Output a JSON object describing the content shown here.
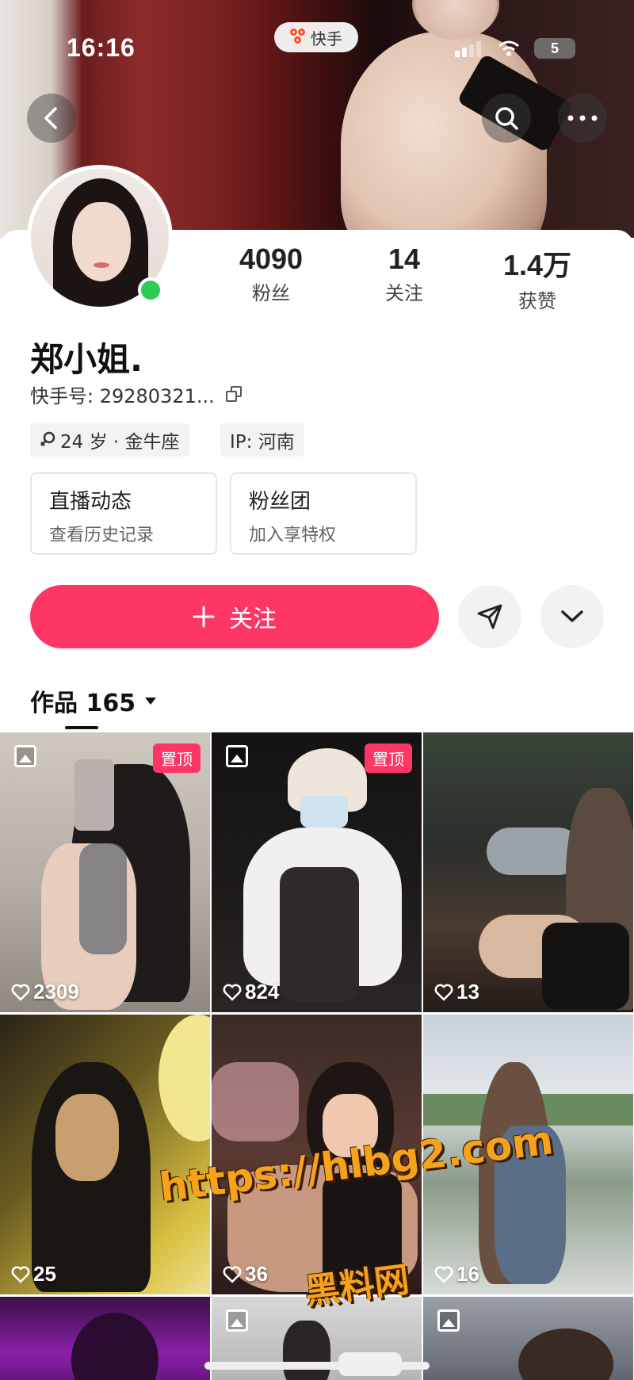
{
  "status_bar": {
    "time": "16:16",
    "app_name": "快手",
    "battery": "5"
  },
  "profile": {
    "name": "郑小姐.",
    "kuaishou_id": "快手号: 29280321...",
    "stats": [
      {
        "value": "4090",
        "label": "粉丝"
      },
      {
        "value": "14",
        "label": "关注"
      },
      {
        "value": "1.4万",
        "label": "获赞"
      }
    ],
    "tags": {
      "age_zodiac": "24 岁 · 金牛座",
      "ip": "IP: 河南"
    }
  },
  "quick_entries": [
    {
      "title": "直播动态",
      "subtitle": "查看历史记录"
    },
    {
      "title": "粉丝团",
      "subtitle": "加入享特权"
    }
  ],
  "actions": {
    "follow_label": "关注"
  },
  "works": {
    "tab_label": "作品 165",
    "items": [
      {
        "likes": "2309",
        "pinned": "置顶"
      },
      {
        "likes": "824",
        "pinned": "置顶"
      },
      {
        "likes": "13"
      },
      {
        "likes": "25"
      },
      {
        "likes": "36"
      },
      {
        "likes": "16"
      }
    ]
  },
  "watermark": {
    "url": "https://hlbg2.com",
    "site": "黑料网"
  },
  "colors": {
    "accent": "#fe3666",
    "online": "#2ecc52",
    "watermark": "#f7a21b"
  }
}
